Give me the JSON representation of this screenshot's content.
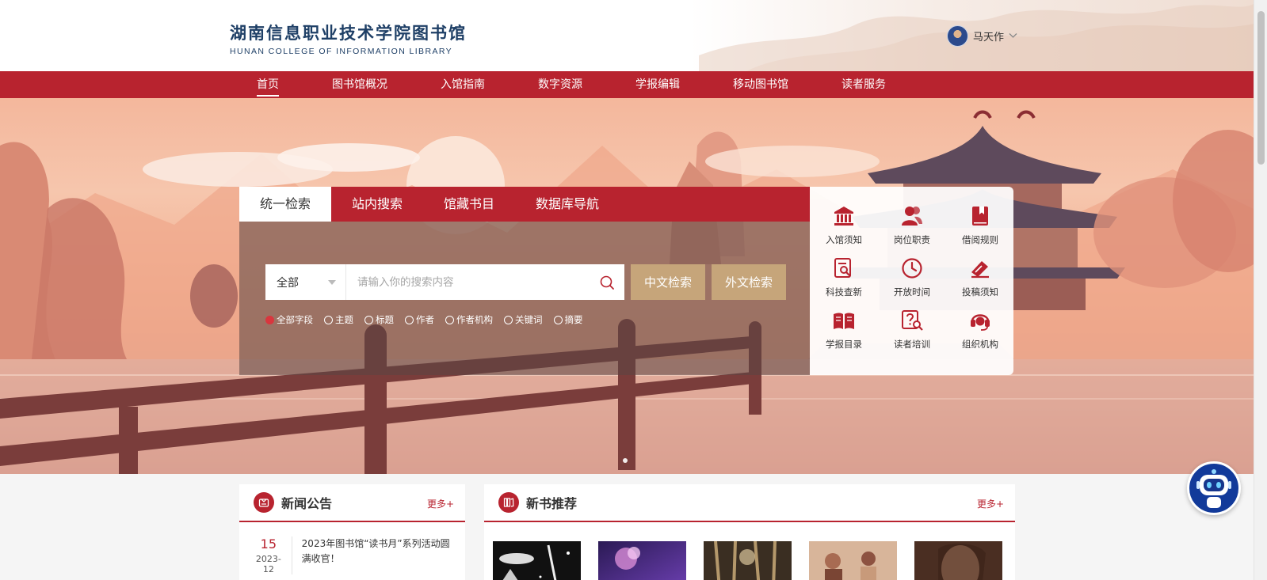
{
  "header": {
    "logo_cn": "湖南信息职业技术学院图书馆",
    "logo_en": "HUNAN COLLEGE OF INFORMATION LIBRARY",
    "user_name": "马天作"
  },
  "nav": {
    "items": [
      "首页",
      "图书馆概况",
      "入馆指南",
      "数字资源",
      "学报编辑",
      "移动图书馆",
      "读者服务"
    ],
    "active": "首页"
  },
  "search": {
    "tabs": [
      "统一检索",
      "站内搜索",
      "馆藏书目",
      "数据库导航"
    ],
    "active_tab": "统一检索",
    "scope_selected": "全部",
    "placeholder": "请输入你的搜索内容",
    "value": "",
    "btn_cn": "中文检索",
    "btn_en": "外文检索",
    "fields": [
      "全部字段",
      "主题",
      "标题",
      "作者",
      "作者机构",
      "关键词",
      "摘要"
    ],
    "field_selected": "全部字段"
  },
  "quick_links": [
    {
      "label": "入馆须知",
      "icon": "museum-icon"
    },
    {
      "label": "岗位职责",
      "icon": "users-icon"
    },
    {
      "label": "借阅规则",
      "icon": "book-bookmark-icon"
    },
    {
      "label": "科技查新",
      "icon": "document-search-icon"
    },
    {
      "label": "开放时间",
      "icon": "clock-icon"
    },
    {
      "label": "投稿须知",
      "icon": "submit-icon"
    },
    {
      "label": "学报目录",
      "icon": "open-book-icon"
    },
    {
      "label": "读者培训",
      "icon": "question-search-icon"
    },
    {
      "label": "组织机构",
      "icon": "headset-icon"
    }
  ],
  "news": {
    "title": "新闻公告",
    "more": "更多+",
    "items": [
      {
        "day": "15",
        "ym": "2023-12",
        "text": "2023年图书馆“读书月”系列活动圆满收官！"
      }
    ]
  },
  "books": {
    "title": "新书推荐",
    "more": "更多+"
  },
  "colors": {
    "brand_red": "#b8232f",
    "search_button": "#c6a57a",
    "logo_blue": "#1e3f66"
  }
}
